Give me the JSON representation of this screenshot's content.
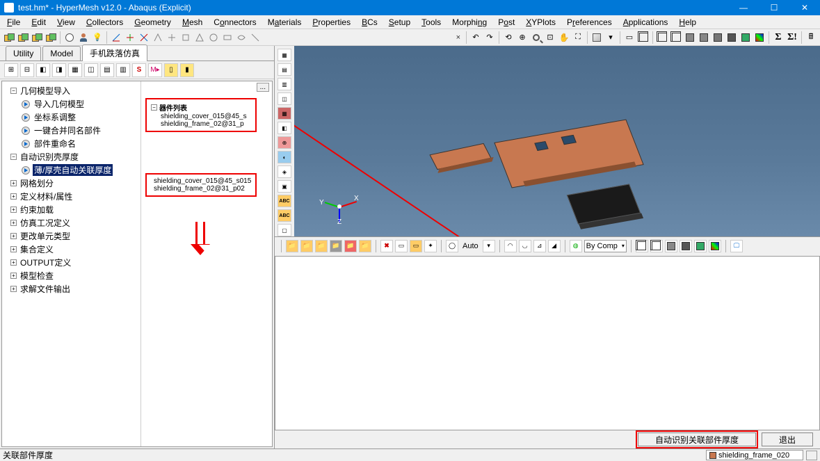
{
  "title": "test.hm* - HyperMesh v12.0 - Abaqus (Explicit)",
  "menu": [
    "File",
    "Edit",
    "View",
    "Collectors",
    "Geometry",
    "Mesh",
    "Connectors",
    "Materials",
    "Properties",
    "BCs",
    "Setup",
    "Tools",
    "Morphing",
    "Post",
    "XYPlots",
    "Preferences",
    "Applications",
    "Help"
  ],
  "tabs": {
    "utility": "Utility",
    "model": "Model",
    "custom": "手机跌落仿真"
  },
  "tree": {
    "n1": "几何模型导入",
    "n1a": "导入几何模型",
    "n1b": "坐标系调整",
    "n1c": "一键合并同名部件",
    "n1d": "部件重命名",
    "n2": "自动识别壳厚度",
    "n2a": "薄/厚壳自动关联厚度",
    "n3": "网格划分",
    "n4": "定义材料/属性",
    "n5": "约束加载",
    "n6": "仿真工况定义",
    "n7": "更改单元类型",
    "n8": "集合定义",
    "n9": "OUTPUT定义",
    "n10": "模型检查",
    "n11": "求解文件输出"
  },
  "parts_box": {
    "title": "器件列表",
    "p1": "shielding_cover_015@45_s",
    "p2": "shielding_frame_02@31_p"
  },
  "mapped_box": {
    "p1": "shielding_cover_015@45_s015",
    "p2": "shielding_frame_02@31_p02"
  },
  "bottom_toolbar": {
    "auto": "Auto",
    "bycomp": "By Comp"
  },
  "actions": {
    "identify": "自动识别关联部件厚度",
    "exit": "退出"
  },
  "status": {
    "left": "关联部件厚度",
    "right": "shielding_frame_020"
  },
  "gizmo": {
    "x": "X",
    "y": "Y",
    "z": "Z"
  }
}
